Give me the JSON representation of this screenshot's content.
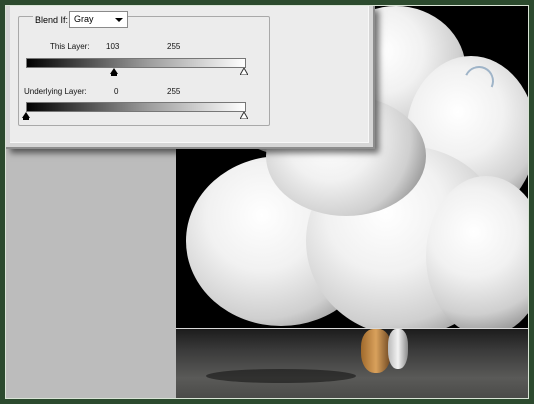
{
  "blend_if": {
    "label": "Blend If:",
    "selected": "Gray",
    "dropdown_icon": "chevron-down-icon"
  },
  "this_layer": {
    "label": "This Layer:",
    "black_value": "103",
    "white_value": "255",
    "black_level": 103,
    "white_level": 255
  },
  "underlying_layer": {
    "label": "Underlying Layer:",
    "black_value": "0",
    "white_value": "255",
    "black_level": 0,
    "white_level": 255
  },
  "colors": {
    "frame": "#2c4a2e",
    "workspace": "#bcbcbc",
    "dialog": "#ececec"
  }
}
